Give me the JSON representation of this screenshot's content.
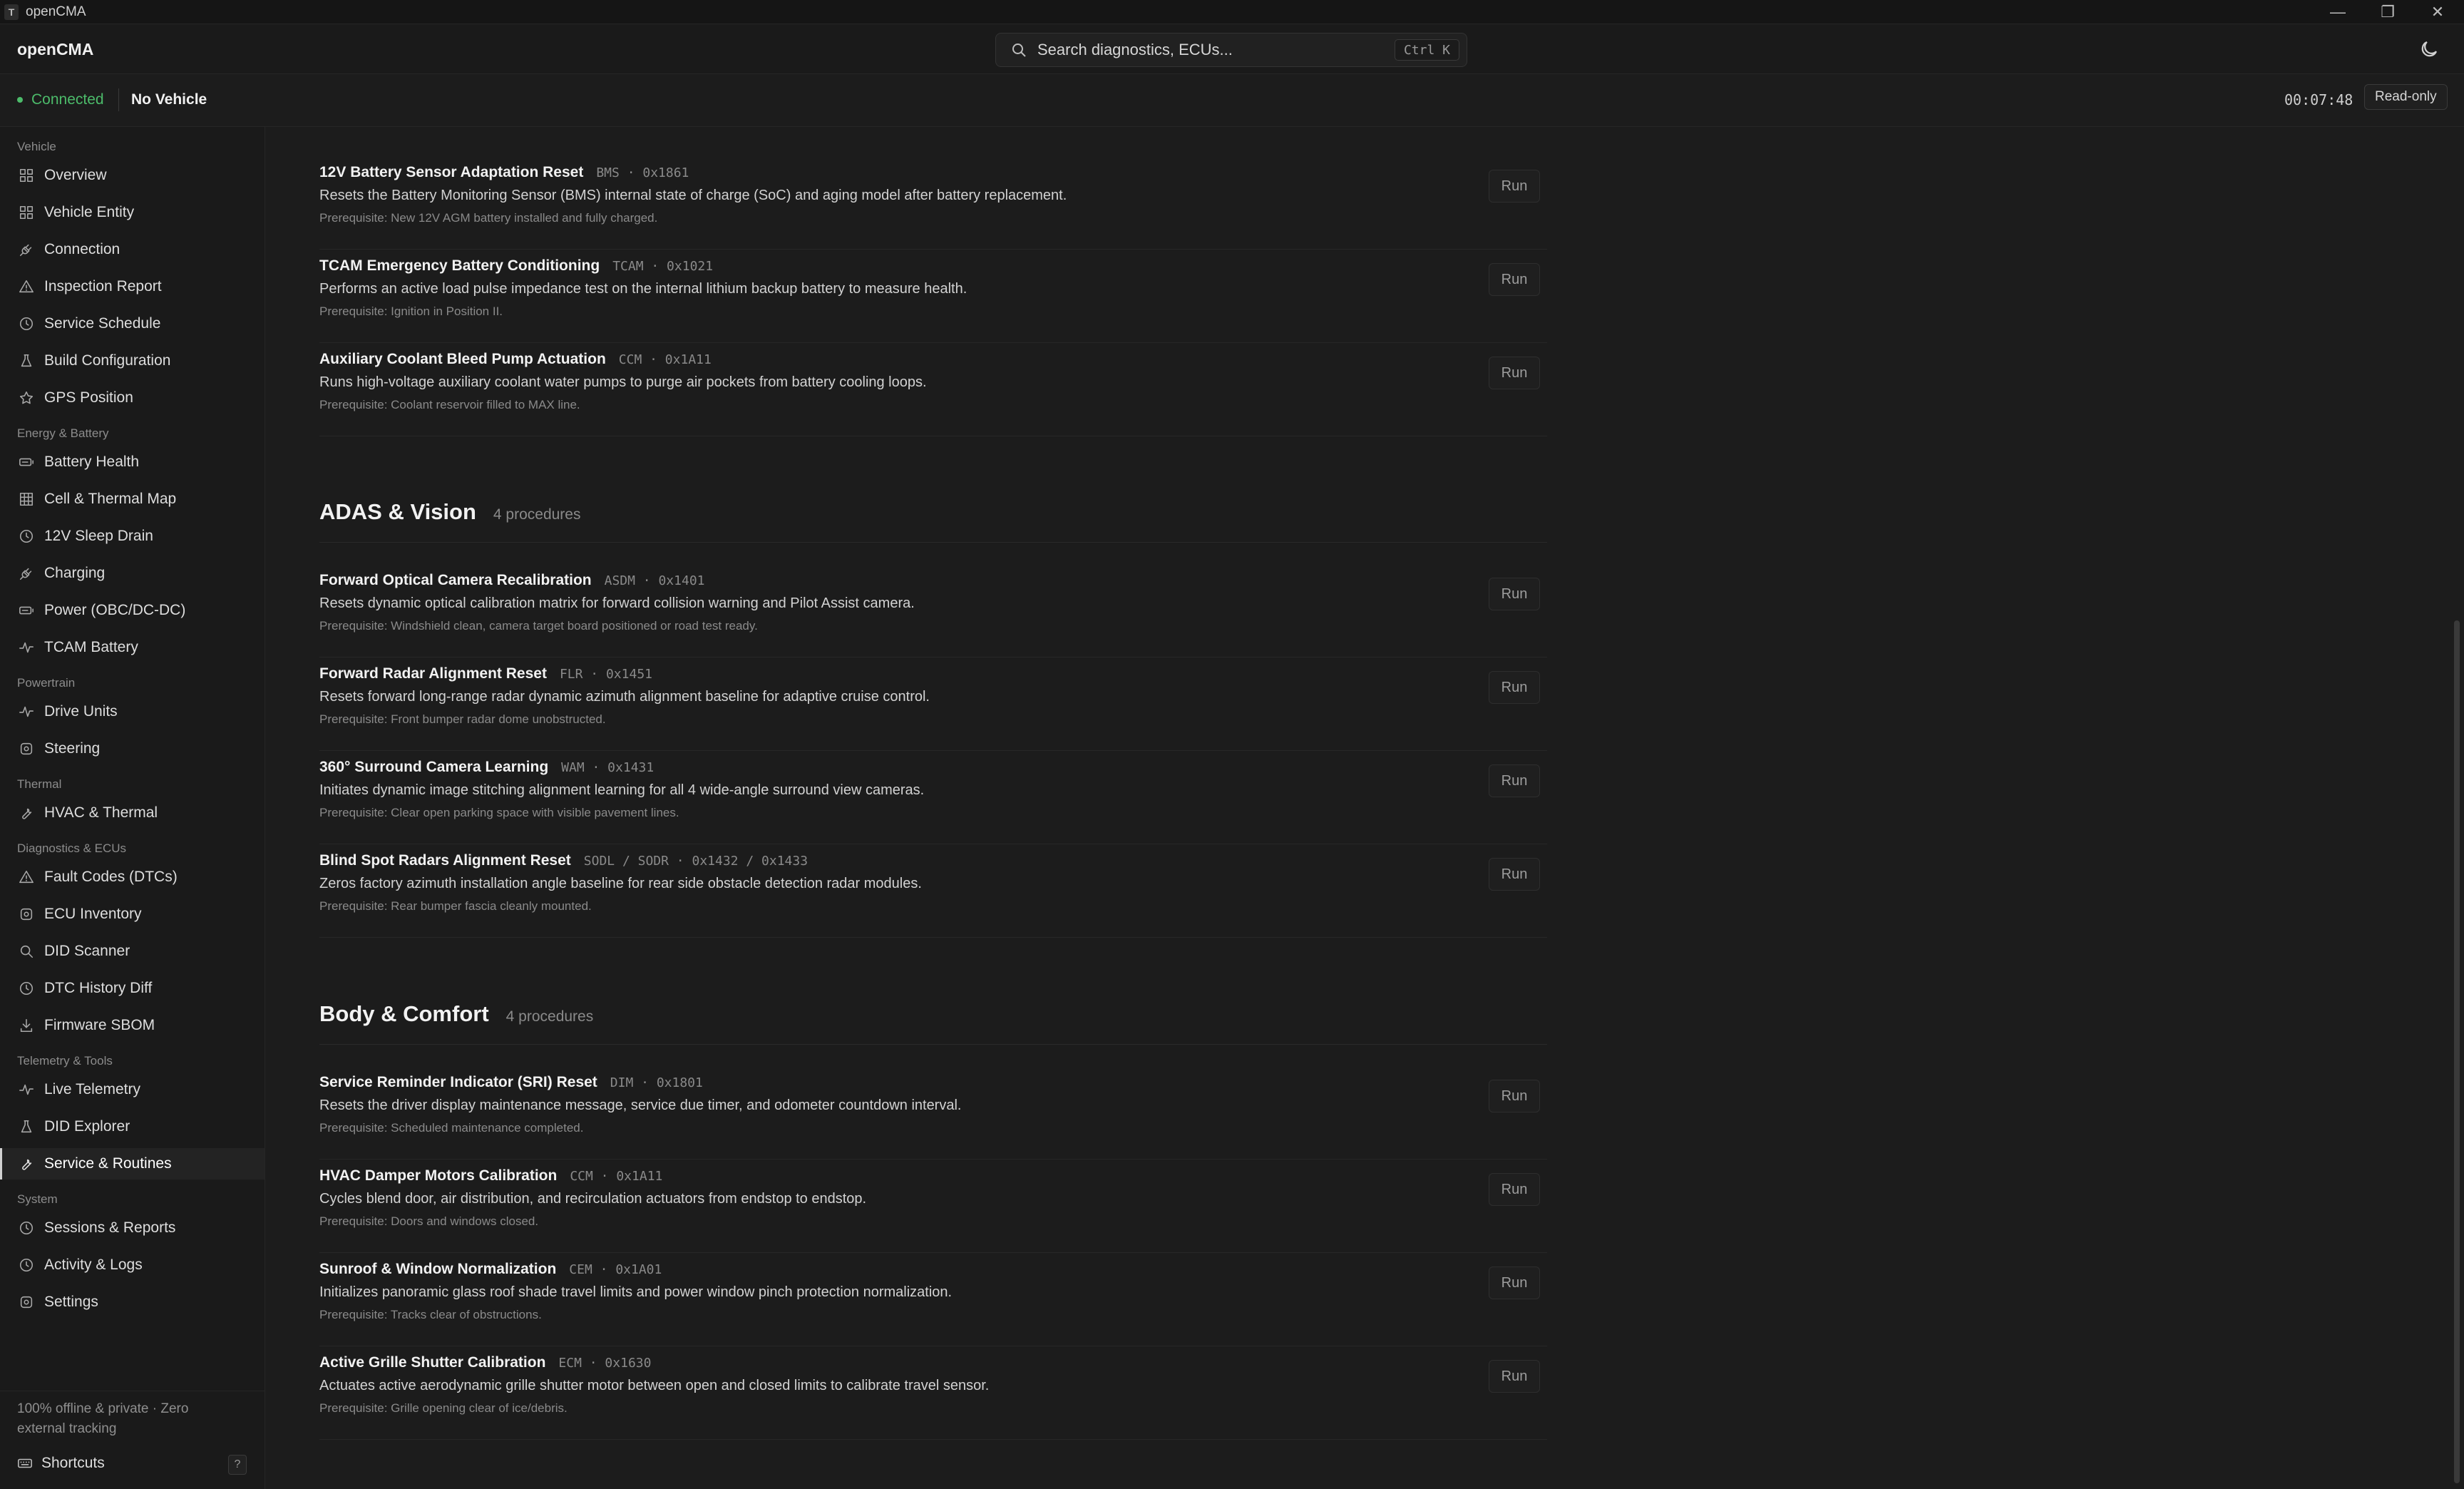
{
  "window": {
    "icon": "T",
    "title": "openCMA",
    "min": "—",
    "max": "❐",
    "close": "✕"
  },
  "header": {
    "brand": "openCMA",
    "search_placeholder": "Search diagnostics, ECUs...",
    "search_shortcut": "Ctrl K"
  },
  "status": {
    "connection": "Connected",
    "vehicle": "No Vehicle",
    "timer": "00:07:48",
    "mode": "Read-only",
    "colors": {
      "connected": "#4cbb6a"
    }
  },
  "sidebar": {
    "sections": [
      {
        "label": "Vehicle",
        "items": [
          {
            "label": "Overview",
            "icon": "grid-icon"
          },
          {
            "label": "Vehicle Entity",
            "icon": "grid-icon"
          },
          {
            "label": "Connection",
            "icon": "plug-icon"
          },
          {
            "label": "Inspection Report",
            "icon": "triangle-icon"
          },
          {
            "label": "Service Schedule",
            "icon": "clock-icon"
          },
          {
            "label": "Build Configuration",
            "icon": "flask-icon"
          },
          {
            "label": "GPS Position",
            "icon": "star-icon"
          }
        ]
      },
      {
        "label": "Energy & Battery",
        "items": [
          {
            "label": "Battery Health",
            "icon": "battery-icon"
          },
          {
            "label": "Cell & Thermal Map",
            "icon": "table-icon"
          },
          {
            "label": "12V Sleep Drain",
            "icon": "clock-icon"
          },
          {
            "label": "Charging",
            "icon": "plug-icon"
          },
          {
            "label": "Power (OBC/DC-DC)",
            "icon": "battery-icon"
          },
          {
            "label": "TCAM Battery",
            "icon": "pulse-icon"
          }
        ]
      },
      {
        "label": "Powertrain",
        "items": [
          {
            "label": "Drive Units",
            "icon": "pulse-icon"
          },
          {
            "label": "Steering",
            "icon": "gear-icon"
          }
        ]
      },
      {
        "label": "Thermal",
        "items": [
          {
            "label": "HVAC & Thermal",
            "icon": "wrench-icon"
          }
        ]
      },
      {
        "label": "Diagnostics & ECUs",
        "items": [
          {
            "label": "Fault Codes (DTCs)",
            "icon": "triangle-icon"
          },
          {
            "label": "ECU Inventory",
            "icon": "gear-icon"
          },
          {
            "label": "DID Scanner",
            "icon": "search-icon"
          },
          {
            "label": "DTC History Diff",
            "icon": "clock-icon"
          },
          {
            "label": "Firmware SBOM",
            "icon": "download-icon"
          }
        ]
      },
      {
        "label": "Telemetry & Tools",
        "items": [
          {
            "label": "Live Telemetry",
            "icon": "pulse-icon"
          },
          {
            "label": "DID Explorer",
            "icon": "flask-icon"
          },
          {
            "label": "Service & Routines",
            "icon": "wrench-icon",
            "active": true
          }
        ]
      },
      {
        "label": "System",
        "items": [
          {
            "label": "Sessions & Reports",
            "icon": "clock-icon"
          },
          {
            "label": "Activity & Logs",
            "icon": "clock-icon"
          },
          {
            "label": "Settings",
            "icon": "gear-icon"
          }
        ]
      }
    ],
    "footer_note": "100% offline & private · Zero external tracking",
    "shortcuts_label": "Shortcuts",
    "shortcuts_key": "?"
  },
  "groups": [
    {
      "title": "",
      "count": "",
      "procedures": [
        {
          "name": "12V Battery Sensor Adaptation Reset",
          "meta": "BMS · 0x1861",
          "desc": "Resets the Battery Monitoring Sensor (BMS) internal state of charge (SoC) and aging model after battery replacement.",
          "prereq": "Prerequisite: New 12V AGM battery installed and fully charged.",
          "run": "Run"
        },
        {
          "name": "TCAM Emergency Battery Conditioning",
          "meta": "TCAM · 0x1021",
          "desc": "Performs an active load pulse impedance test on the internal lithium backup battery to measure health.",
          "prereq": "Prerequisite: Ignition in Position II.",
          "run": "Run"
        },
        {
          "name": "Auxiliary Coolant Bleed Pump Actuation",
          "meta": "CCM · 0x1A11",
          "desc": "Runs high-voltage auxiliary coolant water pumps to purge air pockets from battery cooling loops.",
          "prereq": "Prerequisite: Coolant reservoir filled to MAX line.",
          "run": "Run"
        }
      ]
    },
    {
      "title": "ADAS & Vision",
      "count": "4 procedures",
      "procedures": [
        {
          "name": "Forward Optical Camera Recalibration",
          "meta": "ASDM · 0x1401",
          "desc": "Resets dynamic optical calibration matrix for forward collision warning and Pilot Assist camera.",
          "prereq": "Prerequisite: Windshield clean, camera target board positioned or road test ready.",
          "run": "Run"
        },
        {
          "name": "Forward Radar Alignment Reset",
          "meta": "FLR · 0x1451",
          "desc": "Resets forward long-range radar dynamic azimuth alignment baseline for adaptive cruise control.",
          "prereq": "Prerequisite: Front bumper radar dome unobstructed.",
          "run": "Run"
        },
        {
          "name": "360° Surround Camera Learning",
          "meta": "WAM · 0x1431",
          "desc": "Initiates dynamic image stitching alignment learning for all 4 wide-angle surround view cameras.",
          "prereq": "Prerequisite: Clear open parking space with visible pavement lines.",
          "run": "Run"
        },
        {
          "name": "Blind Spot Radars Alignment Reset",
          "meta": "SODL / SODR · 0x1432 / 0x1433",
          "desc": "Zeros factory azimuth installation angle baseline for rear side obstacle detection radar modules.",
          "prereq": "Prerequisite: Rear bumper fascia cleanly mounted.",
          "run": "Run"
        }
      ]
    },
    {
      "title": "Body & Comfort",
      "count": "4 procedures",
      "procedures": [
        {
          "name": "Service Reminder Indicator (SRI) Reset",
          "meta": "DIM · 0x1801",
          "desc": "Resets the driver display maintenance message, service due timer, and odometer countdown interval.",
          "prereq": "Prerequisite: Scheduled maintenance completed.",
          "run": "Run"
        },
        {
          "name": "HVAC Damper Motors Calibration",
          "meta": "CCM · 0x1A11",
          "desc": "Cycles blend door, air distribution, and recirculation actuators from endstop to endstop.",
          "prereq": "Prerequisite: Doors and windows closed.",
          "run": "Run"
        },
        {
          "name": "Sunroof & Window Normalization",
          "meta": "CEM · 0x1A01",
          "desc": "Initializes panoramic glass roof shade travel limits and power window pinch protection normalization.",
          "prereq": "Prerequisite: Tracks clear of obstructions.",
          "run": "Run"
        },
        {
          "name": "Active Grille Shutter Calibration",
          "meta": "ECM · 0x1630",
          "desc": "Actuates active aerodynamic grille shutter motor between open and closed limits to calibrate travel sensor.",
          "prereq": "Prerequisite: Grille opening clear of ice/debris.",
          "run": "Run"
        }
      ]
    }
  ]
}
